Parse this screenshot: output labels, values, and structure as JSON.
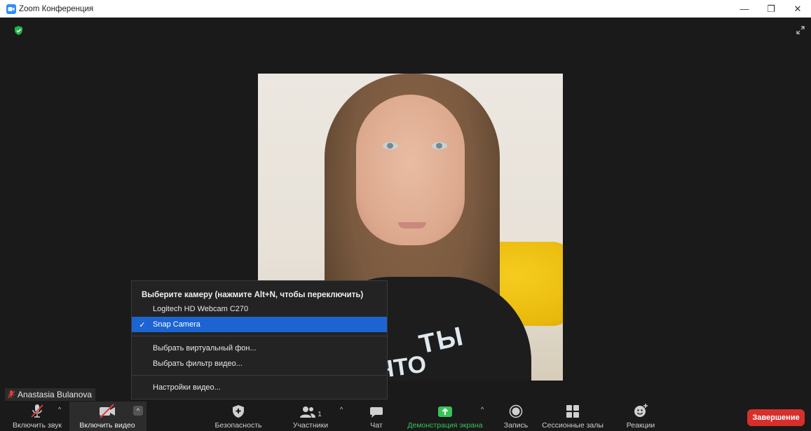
{
  "window": {
    "title": "Zoom Конференция",
    "controls": {
      "minimize": "—",
      "restore": "❐",
      "close": "✕"
    }
  },
  "participant": {
    "name": "Anastasia Bulanova",
    "shirt_text_line1": "ТЫ",
    "shirt_text_line2": "ЧТО"
  },
  "camera_menu": {
    "header": "Выберите камеру (нажмите Alt+N, чтобы переключить)",
    "cameras": [
      {
        "label": "Logitech HD Webcam C270",
        "selected": false
      },
      {
        "label": "Snap Camera",
        "selected": true
      }
    ],
    "check_mark": "✓",
    "actions": [
      "Выбрать виртуальный фон...",
      "Выбрать фильтр видео..."
    ],
    "settings": "Настройки видео..."
  },
  "toolbar": {
    "audio": {
      "label": "Включить звук",
      "icon": "mic-muted-icon"
    },
    "video": {
      "label": "Включить видео",
      "icon": "video-off-icon"
    },
    "security": {
      "label": "Безопасность",
      "icon": "shield-icon"
    },
    "participants": {
      "label": "Участники",
      "count": "1",
      "icon": "participants-icon"
    },
    "chat": {
      "label": "Чат",
      "icon": "chat-icon"
    },
    "share": {
      "label": "Демонстрация экрана",
      "icon": "share-screen-icon"
    },
    "record": {
      "label": "Запись",
      "icon": "record-icon"
    },
    "breakout": {
      "label": "Сессионные залы",
      "icon": "breakout-rooms-icon"
    },
    "reactions": {
      "label": "Реакции",
      "icon": "reactions-icon"
    },
    "caret": "^",
    "end": "Завершение"
  },
  "colors": {
    "accent_blue": "#1c64d1",
    "share_green": "#38c35a",
    "end_red": "#d72f2c",
    "background": "#1a1a1a"
  }
}
